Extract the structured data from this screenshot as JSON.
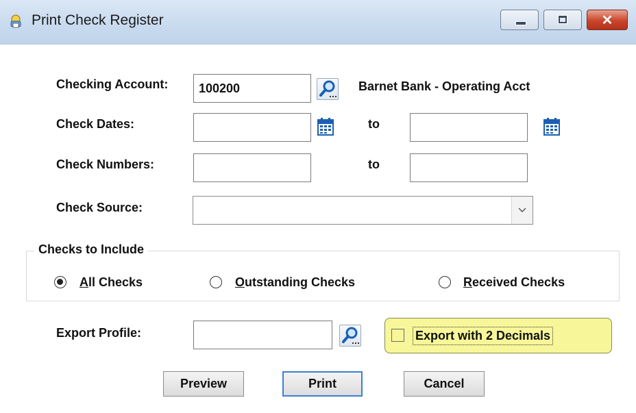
{
  "window": {
    "title": "Print Check Register",
    "icon": "printer-icon"
  },
  "form": {
    "checking_account_label": "Checking Account:",
    "checking_account_value": "100200",
    "checking_account_name": "Barnet Bank - Operating Acct",
    "check_dates_label": "Check Dates:",
    "check_dates_from": "",
    "check_dates_to": "",
    "to_label": "to",
    "check_numbers_label": "Check Numbers:",
    "check_numbers_from": "",
    "check_numbers_to": "",
    "check_source_label": "Check Source:",
    "check_source_value": "",
    "export_profile_label": "Export Profile:",
    "export_profile_value": ""
  },
  "checks_to_include": {
    "title": "Checks to Include",
    "options": [
      {
        "label": "All Checks",
        "mnemonic": "A",
        "rest": "ll Checks",
        "selected": true
      },
      {
        "label": "Outstanding Checks",
        "mnemonic": "O",
        "rest": "utstanding Checks",
        "selected": false
      },
      {
        "label": "Received Checks",
        "mnemonic": "R",
        "rest": "eceived Checks",
        "selected": false
      }
    ]
  },
  "export_decimals": {
    "label": "Export with 2 Decimals",
    "checked": false
  },
  "buttons": {
    "preview": "Preview",
    "print": "Print",
    "cancel": "Cancel"
  },
  "colors": {
    "highlight": "#f7f79a",
    "default_button_border": "#3c7fd1",
    "close_button": "#c9452a"
  }
}
